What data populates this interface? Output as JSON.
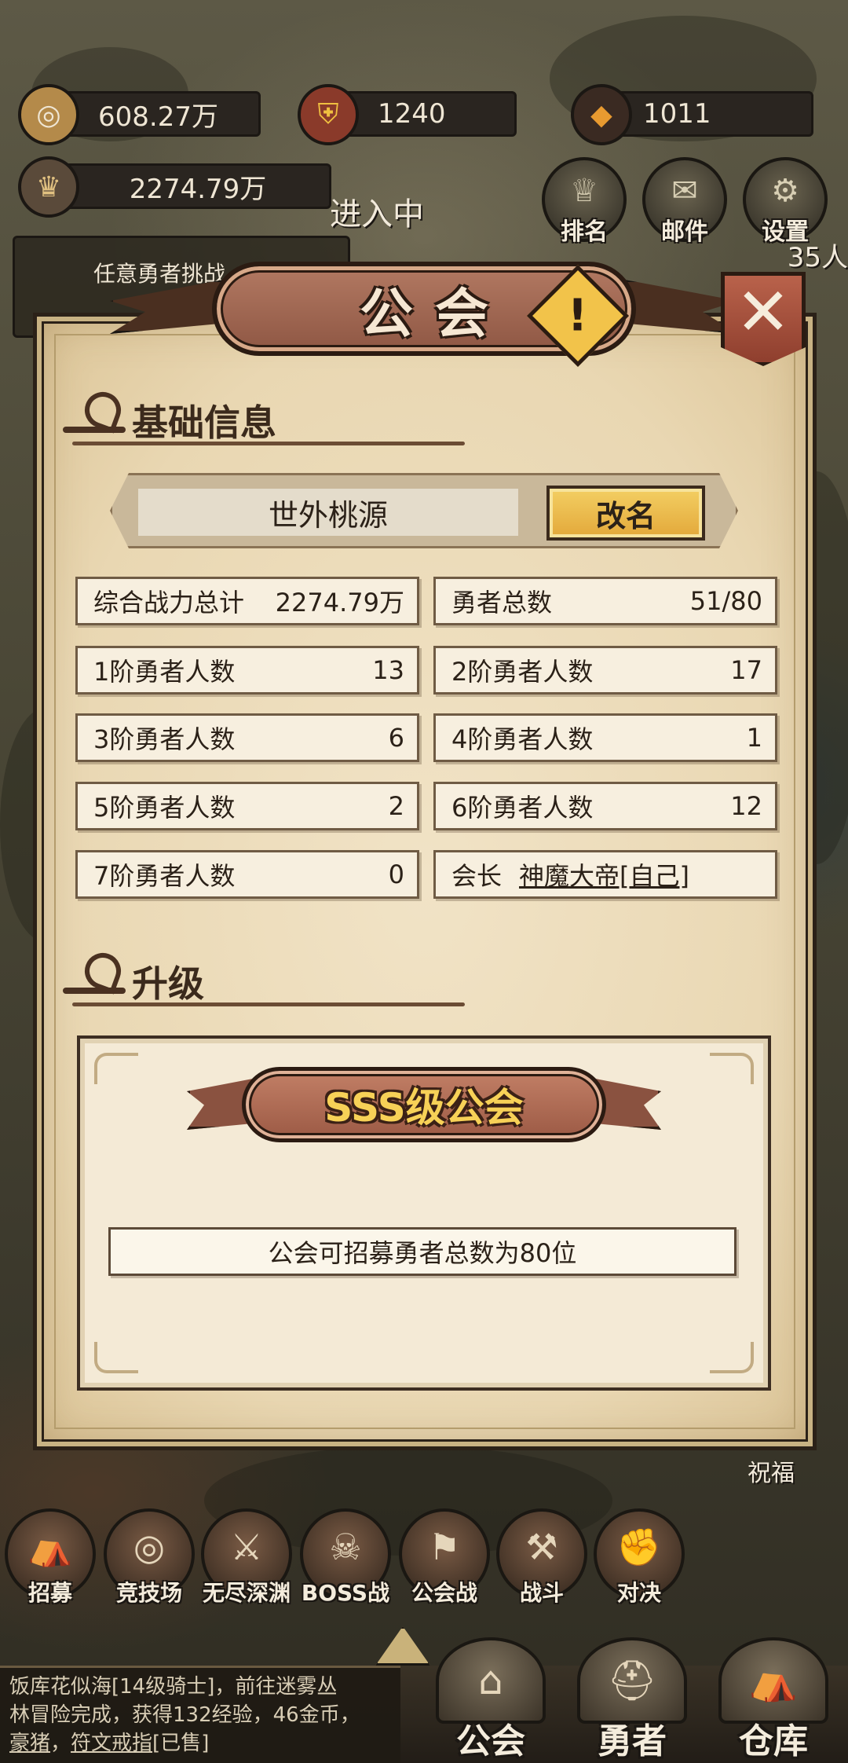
{
  "hud": {
    "gold": "608.27万",
    "shield": "1240",
    "gems": "1011",
    "power": "2274.79万",
    "entering": "进入中",
    "task_text": "任意勇者挑战",
    "side_count": "35人"
  },
  "top_buttons": [
    {
      "label": "排名",
      "icon": "trophy-icon"
    },
    {
      "label": "邮件",
      "icon": "mail-icon"
    },
    {
      "label": "设置",
      "icon": "gear-icon"
    }
  ],
  "modal": {
    "title": "公会",
    "close": "✕",
    "help": "!",
    "section_basic": "基础信息",
    "guild_name": "世外桃源",
    "rename": "改名",
    "stats": [
      {
        "label": "综合战力总计",
        "value": "2274.79万"
      },
      {
        "label": "勇者总数",
        "value": "51/80"
      },
      {
        "label": "1阶勇者人数",
        "value": "13"
      },
      {
        "label": "2阶勇者人数",
        "value": "17"
      },
      {
        "label": "3阶勇者人数",
        "value": "6"
      },
      {
        "label": "4阶勇者人数",
        "value": "1"
      },
      {
        "label": "5阶勇者人数",
        "value": "2"
      },
      {
        "label": "6阶勇者人数",
        "value": "12"
      },
      {
        "label": "7阶勇者人数",
        "value": "0"
      }
    ],
    "leader_label": "会长",
    "leader_name": "神魔大帝[自己]",
    "section_upgrade": "升级",
    "grade": "SSS级公会",
    "recruit_text": "公会可招募勇者总数为80位"
  },
  "bottom": {
    "blessing": "祝福",
    "modes": [
      {
        "label": "招募",
        "icon": "recruit-icon"
      },
      {
        "label": "竞技场",
        "icon": "arena-icon"
      },
      {
        "label": "无尽深渊",
        "icon": "abyss-icon"
      },
      {
        "label": "BOSS战",
        "icon": "boss-icon"
      },
      {
        "label": "公会战",
        "icon": "guild-war-icon"
      },
      {
        "label": "战斗",
        "icon": "battle-icon"
      },
      {
        "label": "对决",
        "icon": "duel-icon"
      }
    ],
    "chat_line1": "饭库花似海[14级骑士]，前往迷雾丛",
    "chat_line2a": "林冒险完成，获得132经验，46金币，",
    "chat_line3a": "豪猪",
    "chat_line3b": "，",
    "chat_line3c": "符文戒指",
    "chat_line3d": "[已售]",
    "nav": [
      {
        "label": "公会",
        "icon": "guild-hall-icon"
      },
      {
        "label": "勇者",
        "icon": "hero-helmet-icon"
      },
      {
        "label": "仓库",
        "icon": "warehouse-icon"
      }
    ]
  },
  "colors": {
    "panel_bg": "#efe0c0",
    "plate": "#a86a55",
    "gold_text": "#f7d157",
    "rename_btn": "#eebc4f"
  }
}
